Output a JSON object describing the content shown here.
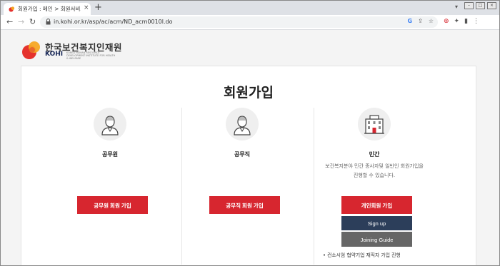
{
  "browser": {
    "tab_title": "회원가입 : 메인 > 회원서비스 >",
    "url": "in.kohi.or.kr/asp/ac/acm/ND_acm0010l.do",
    "new_tab": "+",
    "close": "×",
    "chevron": "⌄"
  },
  "logo": {
    "name": "한국보건복지인재원",
    "en": "KOHI",
    "sub": "KOREA HUMAN RESOURCE DEVELOPMENT INSTITUTE FOR HEALTH & WELFARE"
  },
  "page": {
    "title": "회원가입"
  },
  "columns": [
    {
      "title": "공무원",
      "button": "공무원 회원 가입",
      "icon": "user-icon"
    },
    {
      "title": "공무직",
      "button": "공무직 회원 가입",
      "icon": "user-icon"
    },
    {
      "title": "민간",
      "desc_line1": "보건복지분야 민간 종사자및 일반인 회원가입을",
      "desc_line2": "진행할 수 있습니다.",
      "button": "개인회원 가입",
      "signup": "Sign up",
      "guide": "Joining Guide",
      "note": "• 컨소시엄 협약기업 재직자 가입 진행",
      "icon": "building-icon"
    }
  ],
  "colors": {
    "accent": "#d7262f",
    "navy": "#2c3e5a",
    "gray": "#666666"
  }
}
